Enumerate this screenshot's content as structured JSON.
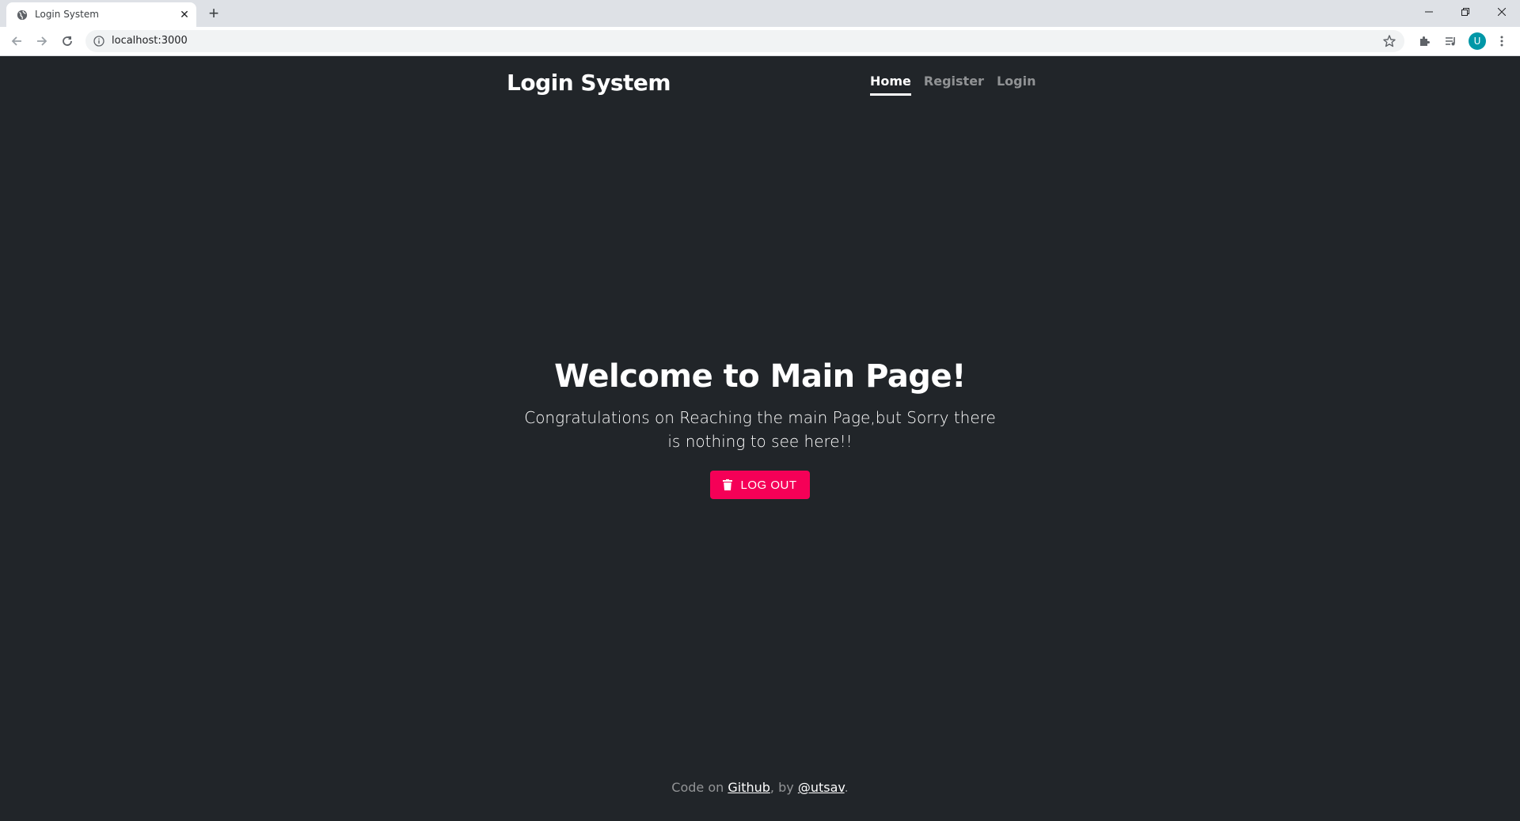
{
  "browser": {
    "tab_title": "Login System",
    "url": "localhost:3000",
    "avatar_initial": "U"
  },
  "page": {
    "brand": "Login System",
    "nav": [
      {
        "label": "Home",
        "active": true
      },
      {
        "label": "Register",
        "active": false
      },
      {
        "label": "Login",
        "active": false
      }
    ],
    "hero": {
      "title": "Welcome to Main Page!",
      "text": "Congratulations on Reaching the main Page,but Sorry there is nothing to see here!!",
      "button_label": "LOG OUT"
    },
    "footer": {
      "prefix": "Code on ",
      "github_label": "Github",
      "middle": ", by ",
      "author_label": "@utsav",
      "suffix": "."
    }
  },
  "colors": {
    "page_bg": "#212529",
    "accent": "#f50057"
  }
}
